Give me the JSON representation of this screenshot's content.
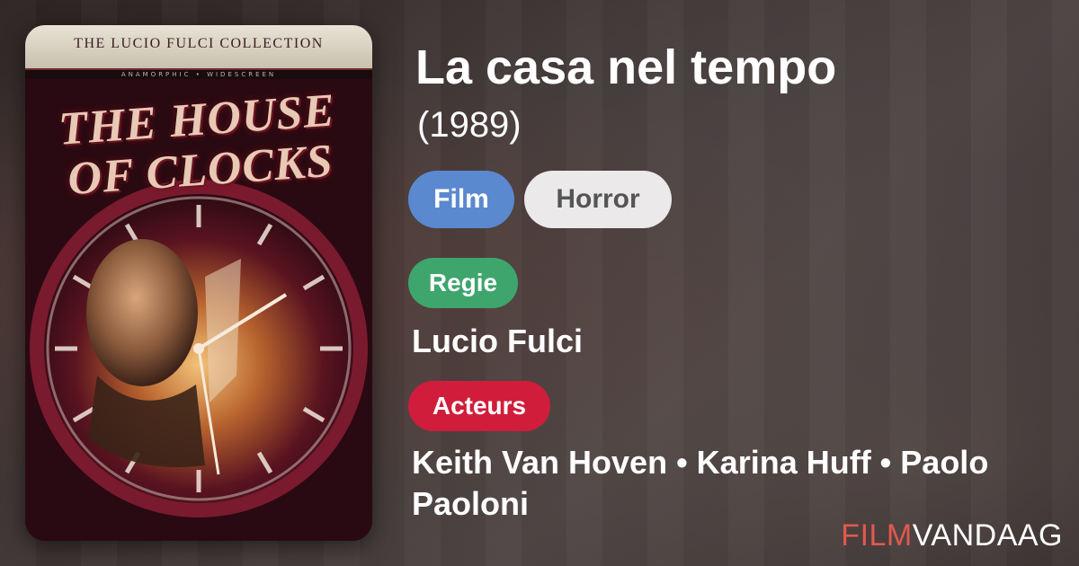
{
  "movie": {
    "title": "La casa nel tempo",
    "year": "(1989)",
    "tags": [
      "Film",
      "Horror"
    ],
    "director_label": "Regie",
    "director": "Lucio Fulci",
    "cast_label": "Acteurs",
    "cast": "Keith Van Hoven • Karina Huff • Paolo Paoloni"
  },
  "poster": {
    "collection_text": "THE LUCIO FULCI COLLECTION",
    "strip_text": "ANAMORPHIC • WIDESCREEN",
    "title_text": "THE HOUSE OF CLOCKS"
  },
  "brand": {
    "part1": "FILM",
    "part2": "VANDAAG"
  },
  "colors": {
    "film_pill": "#5b89cf",
    "genre_pill": "#ebe9e9",
    "director_label": "#3ea56c",
    "cast_label": "#d01d3c",
    "brand_accent": "#e2584e"
  }
}
